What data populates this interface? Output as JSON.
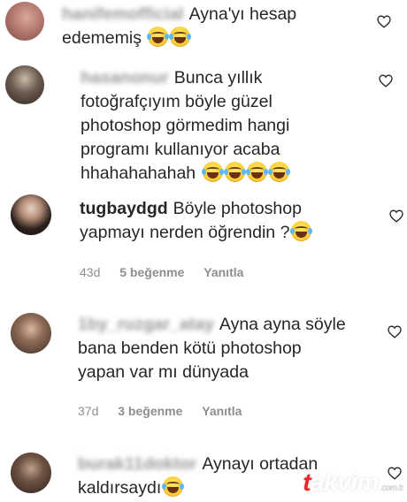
{
  "comments": [
    {
      "username": "hanifemofficial",
      "username_blurred": true,
      "lines": [
        "Ayna'yı hesap",
        "edememiş"
      ],
      "emoji_count": 2,
      "time": "",
      "likes": "",
      "reply": ""
    },
    {
      "username": "hasanonur",
      "username_blurred": true,
      "lines": [
        "Bunca yıllık",
        "fotoğrafçıyım böyle güzel",
        "photoshop görmedim hangi",
        "programı kullanıyor acaba",
        "hhahahahahah"
      ],
      "emoji_count": 4,
      "time": "",
      "likes": "",
      "reply": ""
    },
    {
      "username": "tugbaydgd",
      "username_blurred": false,
      "lines": [
        "Böyle photoshop",
        "yapmayı nerden öğrendin ?"
      ],
      "emoji_count": 1,
      "time": "43d",
      "likes": "5 beğenme",
      "reply": "Yanıtla"
    },
    {
      "username": "1by_ruzgar_atay",
      "username_blurred": true,
      "lines": [
        "Ayna ayna söyle",
        "bana benden kötü photoshop",
        "yapan var mı dünyada"
      ],
      "emoji_count": 0,
      "time": "37d",
      "likes": "3 beğenme",
      "reply": "Yanıtla"
    },
    {
      "username": "burak11doktor",
      "username_blurred": true,
      "lines": [
        "Aynayı ortadan",
        "kaldırsaydı"
      ],
      "emoji_count": 1,
      "time": "",
      "likes": "",
      "reply": ""
    }
  ],
  "watermark": {
    "brand_t": "t",
    "brand_rest": "akvim",
    "tld": ".com.tr"
  },
  "icons": {
    "like": "heart-outline-icon",
    "emoji": "face-with-tears-of-joy-icon"
  },
  "colors": {
    "text": "#262626",
    "meta": "#8e8e8e",
    "heart_stroke": "#262626",
    "watermark_red": "#e8262d"
  }
}
